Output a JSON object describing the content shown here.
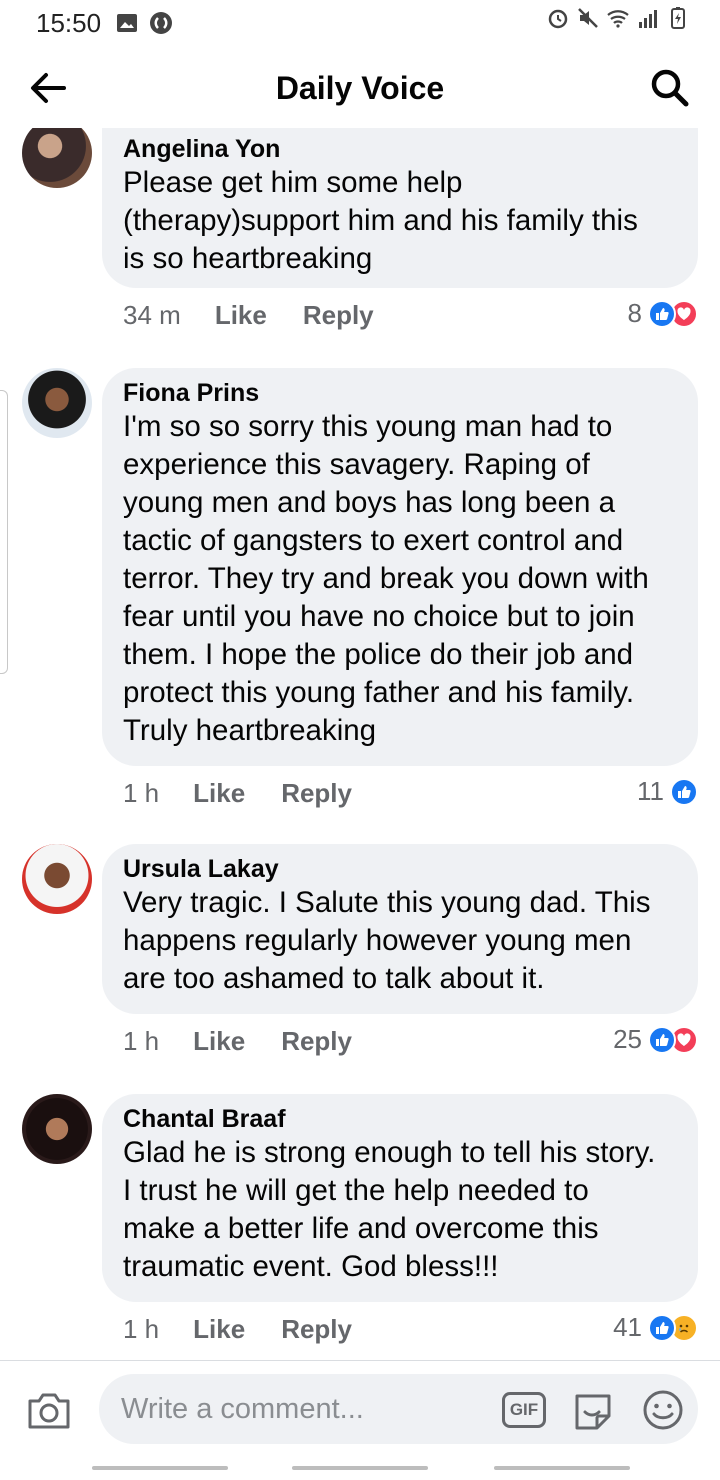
{
  "status_bar": {
    "time": "15:50"
  },
  "header": {
    "title": "Daily Voice"
  },
  "comments": [
    {
      "author": "Angelina Yon",
      "text": "Please get him some help\n(therapy)support him and his family this\nis so heartbreaking",
      "time": "34 m",
      "like_label": "Like",
      "reply_label": "Reply",
      "reaction_count": "8",
      "reactions": [
        "like-icon",
        "love-icon"
      ]
    },
    {
      "author": "Fiona Prins",
      "text": "I'm so so sorry this young man had to\nexperience this savagery. Raping of\nyoung men and boys has long been a\ntactic of gangsters to exert control and\nterror. They try and break you down with\nfear until you have no choice but to join\nthem. I hope the police do their job and\nprotect this young father and his family.\nTruly heartbreaking",
      "time": "1 h",
      "like_label": "Like",
      "reply_label": "Reply",
      "reaction_count": "11",
      "reactions": [
        "like-icon"
      ]
    },
    {
      "author": "Ursula Lakay",
      "text": "Very tragic. I  Salute this young dad. This\nhappens regularly however young men\nare too ashamed to talk about it.",
      "time": "1 h",
      "like_label": "Like",
      "reply_label": "Reply",
      "reaction_count": "25",
      "reactions": [
        "like-icon",
        "love-icon"
      ]
    },
    {
      "author": "Chantal Braaf",
      "text": "Glad he is strong enough to tell his story.\nI trust he will get the help needed to\nmake a better life and overcome this\ntraumatic event. God bless!!!",
      "time": "1 h",
      "like_label": "Like",
      "reply_label": "Reply",
      "reaction_count": "41",
      "reactions": [
        "like-icon",
        "sad-icon"
      ]
    }
  ],
  "composer": {
    "placeholder": "Write a comment...",
    "gif_label": "GIF"
  },
  "colors": {
    "like_blue": "#1877f2",
    "love_red": "#f33e58",
    "sad_yellow": "#f7b125",
    "bubble_bg": "#eff1f4",
    "meta_gray": "#65676b"
  }
}
